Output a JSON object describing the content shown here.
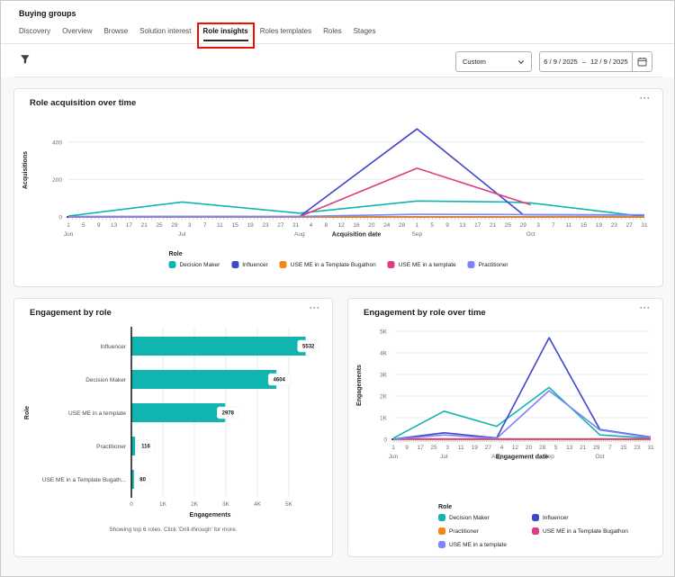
{
  "page": {
    "title": "Buying groups"
  },
  "tabs": [
    "Discovery",
    "Overview",
    "Browse",
    "Solution interest",
    "Role insights",
    "Roles templates",
    "Roles",
    "Stages"
  ],
  "active_tab": "Role insights",
  "filter_bar": {
    "filter_icon": "funnel-icon",
    "preset_dropdown": {
      "value": "Custom",
      "chevron_icon": "chevron-down-icon"
    },
    "date_range": {
      "start": "6 / 9 / 2025",
      "separator": "–",
      "end": "12 / 9 / 2025",
      "calendar_icon": "calendar-icon"
    }
  },
  "ui": {
    "more_glyph": "···"
  },
  "colors": {
    "teal": "#0FB5AE",
    "blue": "#4046CA",
    "orange": "#F68511",
    "pink": "#DE3D82",
    "purple": "#7E84FA",
    "annotation_red": "#EB1000",
    "axis": "#141414",
    "grid": "#ECECEC",
    "tick_text": "#6D6D6D",
    "card_bg": "#FFFFFF",
    "page_bg": "#F8F8F8"
  },
  "chart_data": [
    {
      "id": "role-acquisition-over-time",
      "type": "line",
      "title": "Role acquisition over time",
      "xlabel": "Acquisition date",
      "ylabel": "Acquisitions",
      "ylim": [
        0,
        500
      ],
      "grid": true,
      "y_ticks": [
        {
          "label": "0",
          "value": 0
        },
        {
          "label": "200",
          "value": 200
        },
        {
          "label": "400",
          "value": 400
        }
      ],
      "x_range": [
        "Jun 1",
        "Oct 31"
      ],
      "x_ticks": [
        [
          "Jun",
          [
            1,
            5,
            9,
            13,
            17,
            21,
            25,
            29
          ]
        ],
        [
          "Jul",
          [
            3,
            7,
            11,
            15,
            19,
            23,
            27,
            31
          ]
        ],
        [
          "Aug",
          [
            4,
            8,
            12,
            16,
            20,
            24,
            28
          ]
        ],
        [
          "Sep",
          [
            1,
            5,
            9,
            13,
            17,
            21,
            25,
            29
          ]
        ],
        [
          "Oct",
          [
            3,
            7,
            11,
            15,
            19,
            23,
            27,
            31
          ]
        ]
      ],
      "legend_title": "Role",
      "legend_position": "bottom-center",
      "series": [
        {
          "name": "Decision Maker",
          "color_key": "teal",
          "points": [
            [
              "Jun 1",
              5
            ],
            [
              "Jul 1",
              80
            ],
            [
              "Aug 1",
              20
            ],
            [
              "Sep 1",
              85
            ],
            [
              "Sep 25",
              80
            ],
            [
              "Oct 1",
              75
            ],
            [
              "Oct 31",
              2
            ]
          ]
        },
        {
          "name": "Influencer",
          "color_key": "blue",
          "points": [
            [
              "Jun 1",
              2
            ],
            [
              "Aug 1",
              2
            ],
            [
              "Sep 1",
              470
            ],
            [
              "Sep 29",
              12
            ],
            [
              "Oct 31",
              10
            ]
          ]
        },
        {
          "name": "USE ME in a Template Bugathon",
          "color_key": "orange",
          "points": [
            [
              "Jun 1",
              0
            ],
            [
              "Oct 31",
              0
            ]
          ]
        },
        {
          "name": "USE ME in a template",
          "color_key": "pink",
          "points": [
            [
              "Aug 1",
              2
            ],
            [
              "Sep 1",
              260
            ],
            [
              "Oct 1",
              65
            ]
          ]
        },
        {
          "name": "Practitioner",
          "color_key": "purple",
          "points": [
            [
              "Jun 1",
              1
            ],
            [
              "Aug 1",
              3
            ],
            [
              "Sep 1",
              14
            ],
            [
              "Oct 31",
              11
            ]
          ]
        }
      ]
    },
    {
      "id": "engagement-by-role",
      "type": "bar",
      "title": "Engagement by role",
      "xlabel": "Engagements",
      "ylabel": "Role",
      "categories": [
        "Influencer",
        "Decision Maker",
        "USE ME in a template",
        "Practitioner",
        "USE ME in a Template Bugath..."
      ],
      "values": [
        5532,
        4604,
        2978,
        116,
        80
      ],
      "bar_color_key": "teal",
      "x_ticks": [
        "0",
        "1K",
        "2K",
        "3K",
        "4K",
        "5K"
      ],
      "xlim": [
        0,
        5500
      ],
      "grid": true,
      "footnote": "Showing top 6 roles. Click 'Drill-through' for more."
    },
    {
      "id": "engagement-by-role-over-time",
      "type": "line",
      "title": "Engagement by role over time",
      "xlabel": "Engagement date",
      "ylabel": "Engagements",
      "ylim": [
        0,
        5000
      ],
      "grid": true,
      "y_ticks": [
        {
          "label": "0",
          "value": 0
        },
        {
          "label": "1K",
          "value": 1000
        },
        {
          "label": "2K",
          "value": 2000
        },
        {
          "label": "3K",
          "value": 3000
        },
        {
          "label": "4K",
          "value": 4000
        },
        {
          "label": "5K",
          "value": 5000
        }
      ],
      "x_range": [
        "Jun 1",
        "Oct 31"
      ],
      "x_ticks": [
        [
          "Jun",
          [
            1,
            9,
            17,
            25
          ]
        ],
        [
          "Jul",
          [
            3,
            11,
            19,
            27
          ]
        ],
        [
          "Aug",
          [
            4,
            12,
            20,
            28
          ]
        ],
        [
          "Sep",
          [
            5,
            13,
            21,
            29
          ]
        ],
        [
          "Oct",
          [
            7,
            15,
            23,
            31
          ]
        ]
      ],
      "legend_title": "Role",
      "legend_position": "bottom-left-two-columns",
      "series": [
        {
          "name": "Decision Maker",
          "color_key": "teal",
          "points": [
            [
              "Jun 1",
              50
            ],
            [
              "Jul 1",
              1300
            ],
            [
              "Aug 1",
              600
            ],
            [
              "Sep 1",
              2400
            ],
            [
              "Oct 1",
              200
            ],
            [
              "Oct 31",
              50
            ]
          ]
        },
        {
          "name": "Influencer",
          "color_key": "blue",
          "points": [
            [
              "Jun 1",
              10
            ],
            [
              "Jul 1",
              300
            ],
            [
              "Aug 1",
              60
            ],
            [
              "Sep 1",
              4700
            ],
            [
              "Oct 1",
              450
            ],
            [
              "Oct 31",
              100
            ]
          ]
        },
        {
          "name": "Practitioner",
          "color_key": "orange",
          "points": [
            [
              "Jun 1",
              0
            ],
            [
              "Oct 31",
              0
            ]
          ]
        },
        {
          "name": "USE ME in a Template Bugathon",
          "color_key": "pink",
          "points": [
            [
              "Jun 1",
              15
            ],
            [
              "Oct 31",
              15
            ]
          ]
        },
        {
          "name": "USE ME in a template",
          "color_key": "purple",
          "points": [
            [
              "Jun 1",
              5
            ],
            [
              "Jul 1",
              200
            ],
            [
              "Aug 1",
              40
            ],
            [
              "Sep 1",
              2250
            ],
            [
              "Oct 1",
              430
            ],
            [
              "Oct 31",
              80
            ]
          ]
        }
      ]
    }
  ]
}
